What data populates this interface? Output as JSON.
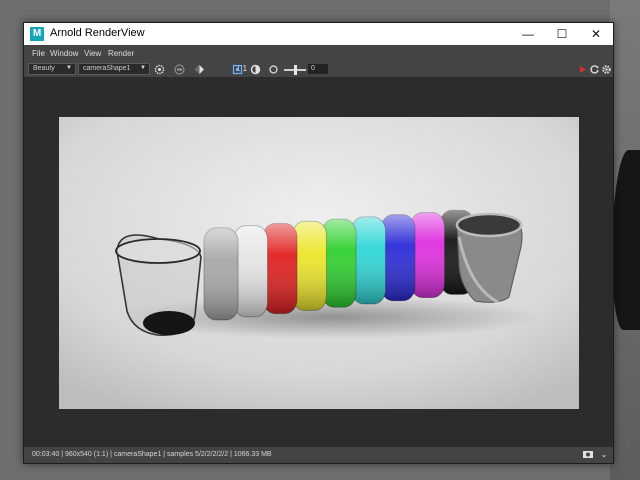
{
  "window": {
    "title": "Arnold RenderView",
    "app_icon_letter": "M",
    "minimize": "—",
    "maximize": "☐",
    "close": "✕"
  },
  "menu": [
    "File",
    "Window",
    "View",
    "Render"
  ],
  "toolbar": {
    "aov_select": "Beauty",
    "camera_select": "cameraShape1",
    "zoom_label": "1:1",
    "exposure_value": "0"
  },
  "status": {
    "text": "00:03:40 | 960x540 (1:1) | cameraShape1 | samples 5/2/2/2/2/2 | 1066.33 MB"
  },
  "colors": {
    "accent_stop": "#d03030",
    "ring_colors": [
      "#a8a8a8",
      "#e4e4e4",
      "#e02020",
      "#ece62a",
      "#2fd02f",
      "#2fd6d6",
      "#2b2bd8",
      "#e02ee0",
      "#151515"
    ]
  }
}
